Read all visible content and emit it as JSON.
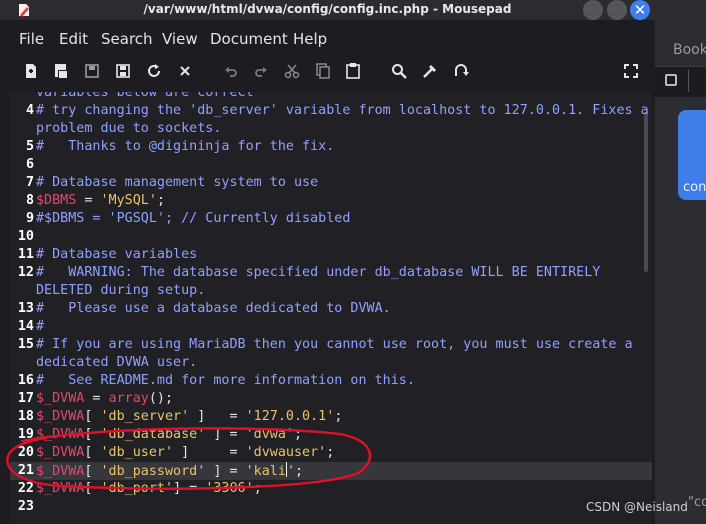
{
  "window": {
    "title": "/var/www/html/dvwa/config/config.inc.php - Mousepad",
    "close_glyph": "✕"
  },
  "menu": [
    "File",
    "Edit",
    "Search",
    "View",
    "Document",
    "Help"
  ],
  "toolbar_icons": [
    "new-file-icon",
    "new-window-icon",
    "save-icon",
    "save-as-icon",
    "reload-icon",
    "close-icon",
    "undo-icon",
    "redo-icon",
    "cut-icon",
    "copy-icon",
    "paste-icon",
    "find-icon",
    "find-replace-icon",
    "goto-icon",
    "fullscreen-icon"
  ],
  "editor": {
    "lines": [
      {
        "n": "",
        "segs": [
          {
            "t": "variables below are correct",
            "c": "com"
          }
        ]
      },
      {
        "n": "4",
        "segs": [
          {
            "t": "# try changing the 'db_server' variable from localhost to 127.0.0.1. Fixes a",
            "c": "com"
          }
        ]
      },
      {
        "n": "",
        "segs": [
          {
            "t": "problem due to sockets.",
            "c": "com"
          }
        ]
      },
      {
        "n": "5",
        "segs": [
          {
            "t": "#   Thanks to @digininja for the fix.",
            "c": "com"
          }
        ]
      },
      {
        "n": "6",
        "segs": []
      },
      {
        "n": "7",
        "segs": [
          {
            "t": "# Database management system to use",
            "c": "com"
          }
        ]
      },
      {
        "n": "8",
        "segs": [
          {
            "t": "$DBMS",
            "c": "var"
          },
          {
            "t": " = ",
            "c": "op"
          },
          {
            "t": "'MySQL'",
            "c": "str"
          },
          {
            "t": ";",
            "c": "op"
          }
        ]
      },
      {
        "n": "9",
        "segs": [
          {
            "t": "#$DBMS = 'PGSQL'; // Currently disabled",
            "c": "com"
          }
        ]
      },
      {
        "n": "10",
        "segs": []
      },
      {
        "n": "11",
        "segs": [
          {
            "t": "# Database variables",
            "c": "com"
          }
        ]
      },
      {
        "n": "12",
        "segs": [
          {
            "t": "#   WARNING: The database specified under db_database WILL BE ENTIRELY",
            "c": "com"
          }
        ]
      },
      {
        "n": "",
        "segs": [
          {
            "t": "DELETED during setup.",
            "c": "com"
          }
        ]
      },
      {
        "n": "13",
        "segs": [
          {
            "t": "#   Please use a database dedicated to DVWA.",
            "c": "com"
          }
        ]
      },
      {
        "n": "14",
        "segs": [
          {
            "t": "#",
            "c": "com"
          }
        ]
      },
      {
        "n": "15",
        "segs": [
          {
            "t": "# If you are using MariaDB then you cannot use root, you must use create a",
            "c": "com"
          }
        ]
      },
      {
        "n": "",
        "segs": [
          {
            "t": "dedicated DVWA user.",
            "c": "com"
          }
        ]
      },
      {
        "n": "16",
        "segs": [
          {
            "t": "#   See README.md for more information on this.",
            "c": "com"
          }
        ]
      },
      {
        "n": "17",
        "segs": [
          {
            "t": "$_DVWA",
            "c": "var"
          },
          {
            "t": " = ",
            "c": "op"
          },
          {
            "t": "array",
            "c": "fn"
          },
          {
            "t": "();",
            "c": "op"
          }
        ]
      },
      {
        "n": "18",
        "segs": [
          {
            "t": "$_DVWA",
            "c": "var"
          },
          {
            "t": "[ ",
            "c": "op"
          },
          {
            "t": "'db_server'",
            "c": "str"
          },
          {
            "t": " ]   = ",
            "c": "op"
          },
          {
            "t": "'127.0.0.1'",
            "c": "str"
          },
          {
            "t": ";",
            "c": "op"
          }
        ]
      },
      {
        "n": "19",
        "segs": [
          {
            "t": "$_DVWA",
            "c": "var"
          },
          {
            "t": "[ ",
            "c": "op"
          },
          {
            "t": "'db_database'",
            "c": "str"
          },
          {
            "t": " ] = ",
            "c": "op"
          },
          {
            "t": "'dvwa'",
            "c": "str"
          },
          {
            "t": ";",
            "c": "op"
          }
        ]
      },
      {
        "n": "20",
        "segs": [
          {
            "t": "$_DVWA",
            "c": "var"
          },
          {
            "t": "[ ",
            "c": "op"
          },
          {
            "t": "'db_user'",
            "c": "str"
          },
          {
            "t": " ]     = ",
            "c": "op"
          },
          {
            "t": "'dvwauser'",
            "c": "str"
          },
          {
            "t": ";",
            "c": "op"
          }
        ]
      },
      {
        "n": "21",
        "segs": [
          {
            "t": "$_DVWA",
            "c": "var"
          },
          {
            "t": "[ ",
            "c": "op"
          },
          {
            "t": "'db_password'",
            "c": "str"
          },
          {
            "t": " ] = ",
            "c": "op"
          },
          {
            "t": "'kali",
            "c": "str"
          },
          {
            "t": "|",
            "c": "cursor"
          },
          {
            "t": "'",
            "c": "str"
          },
          {
            "t": ";",
            "c": "op"
          }
        ],
        "current": true
      },
      {
        "n": "22",
        "segs": [
          {
            "t": "$_DVWA",
            "c": "var"
          },
          {
            "t": "[ ",
            "c": "op"
          },
          {
            "t": "'db_port'",
            "c": "str"
          },
          {
            "t": "] = ",
            "c": "op"
          },
          {
            "t": "'3306'",
            "c": "str"
          },
          {
            "t": ";",
            "c": "op"
          }
        ]
      },
      {
        "n": "23",
        "segs": []
      }
    ]
  },
  "background_app": {
    "book_text": "Book",
    "card_text": "con",
    "bottom_text": "\"co"
  },
  "watermark": "CSDN @Neisland",
  "colors": {
    "annotation": "#e0102a",
    "accent": "#3d7ff0"
  }
}
